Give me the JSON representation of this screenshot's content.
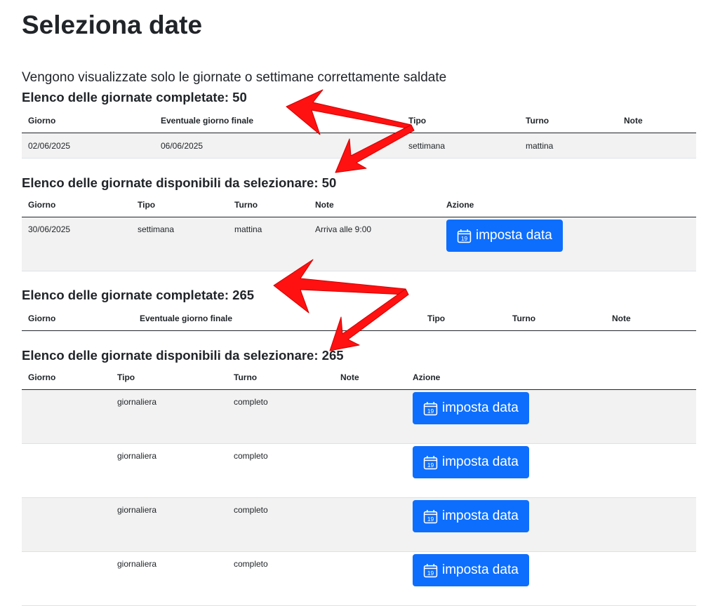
{
  "page": {
    "title": "Seleziona date",
    "intro": "Vengono visualizzate solo le giornate o settimane correttamente saldate"
  },
  "sections": [
    {
      "title": "Elenco delle giornate completate: 50",
      "columns": [
        "Giorno",
        "Eventuale giorno finale",
        "Tipo",
        "Turno",
        "Note"
      ],
      "rows": [
        {
          "giorno": "02/06/2025",
          "finale": "06/06/2025",
          "tipo": "settimana",
          "turno": "mattina",
          "note": ""
        }
      ]
    },
    {
      "title": "Elenco delle giornate disponibili da selezionare: 50",
      "columns": [
        "Giorno",
        "Tipo",
        "Turno",
        "Note",
        "Azione"
      ],
      "rows": [
        {
          "giorno": "30/06/2025",
          "tipo": "settimana",
          "turno": "mattina",
          "note": "Arriva alle 9:00",
          "azione": "imposta data"
        }
      ]
    },
    {
      "title": "Elenco delle giornate completate: 265",
      "columns": [
        "Giorno",
        "Eventuale giorno finale",
        "Tipo",
        "Turno",
        "Note"
      ],
      "rows": []
    },
    {
      "title": "Elenco delle giornate disponibili da selezionare: 265",
      "columns": [
        "Giorno",
        "Tipo",
        "Turno",
        "Note",
        "Azione"
      ],
      "rows": [
        {
          "giorno": "",
          "tipo": "giornaliera",
          "turno": "completo",
          "note": "",
          "azione": "imposta data"
        },
        {
          "giorno": "",
          "tipo": "giornaliera",
          "turno": "completo",
          "note": "",
          "azione": "imposta data"
        },
        {
          "giorno": "",
          "tipo": "giornaliera",
          "turno": "completo",
          "note": "",
          "azione": "imposta data"
        },
        {
          "giorno": "",
          "tipo": "giornaliera",
          "turno": "completo",
          "note": "",
          "azione": "imposta data"
        }
      ]
    }
  ],
  "icons": {
    "button_icon": "calendar-icon",
    "calendar_day": "19"
  },
  "colors": {
    "button": "#0d6efd",
    "row_stripe": "#f2f2f2",
    "annotation_arrow": "#ff0000"
  }
}
